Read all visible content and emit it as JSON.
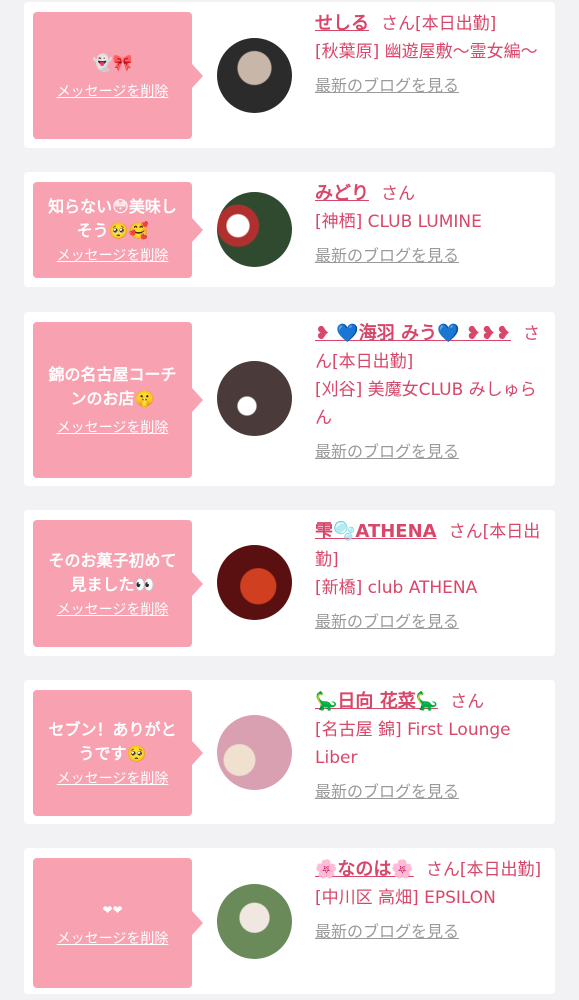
{
  "common": {
    "delete_label": "メッセージを削除",
    "blog_label": "最新のブログを見る",
    "san": "さん"
  },
  "cards": [
    {
      "message": "👻🎀",
      "name": "せしる",
      "status": "[本日出勤]",
      "shop": "[秋葉原] 幽遊屋敷〜霊女編〜",
      "avatar_colors": [
        "#2b2b2b",
        "#c8b7a8"
      ]
    },
    {
      "message": "知らない😳美味し\nそう🥺🥰",
      "name": "みどり",
      "status": "",
      "shop": "[神栖] CLUB LUMINE",
      "avatar_colors": [
        "#2f4a2f",
        "#b03030"
      ]
    },
    {
      "message": "錦の名古屋コーチ\nンのお店🤫",
      "name_prefix": "❥ 💙",
      "name": "海羽 みう",
      "name_suffix": "💙 ❥❥❥",
      "status": "[本日出勤]",
      "shop": "[刈谷] 美魔女CLUB みしゅらん",
      "avatar_colors": [
        "#4a3a3a",
        "#d8c8c0"
      ]
    },
    {
      "message": "そのお菓子初めて\n見ました👀",
      "name": "雫🫧ATHENA",
      "status": "[本日出勤]",
      "shop": "[新橋] club ATHENA",
      "avatar_colors": [
        "#5a1010",
        "#d04020"
      ]
    },
    {
      "message": "セブン！ありがと\nうです🥺",
      "name_prefix": "🦕",
      "name": "日向 花菜",
      "name_suffix": "🦕",
      "status": "",
      "shop": "[名古屋 錦] First Lounge Liber",
      "avatar_colors": [
        "#d8a0b0",
        "#f0e0d0"
      ]
    },
    {
      "message": "❤❤",
      "name_prefix": "🌸",
      "name": "なのは",
      "name_suffix": "🌸",
      "status": "[本日出勤]",
      "shop": "[中川区 高畑] EPSILON",
      "avatar_colors": [
        "#6a8a5a",
        "#f0e8e0"
      ]
    }
  ]
}
